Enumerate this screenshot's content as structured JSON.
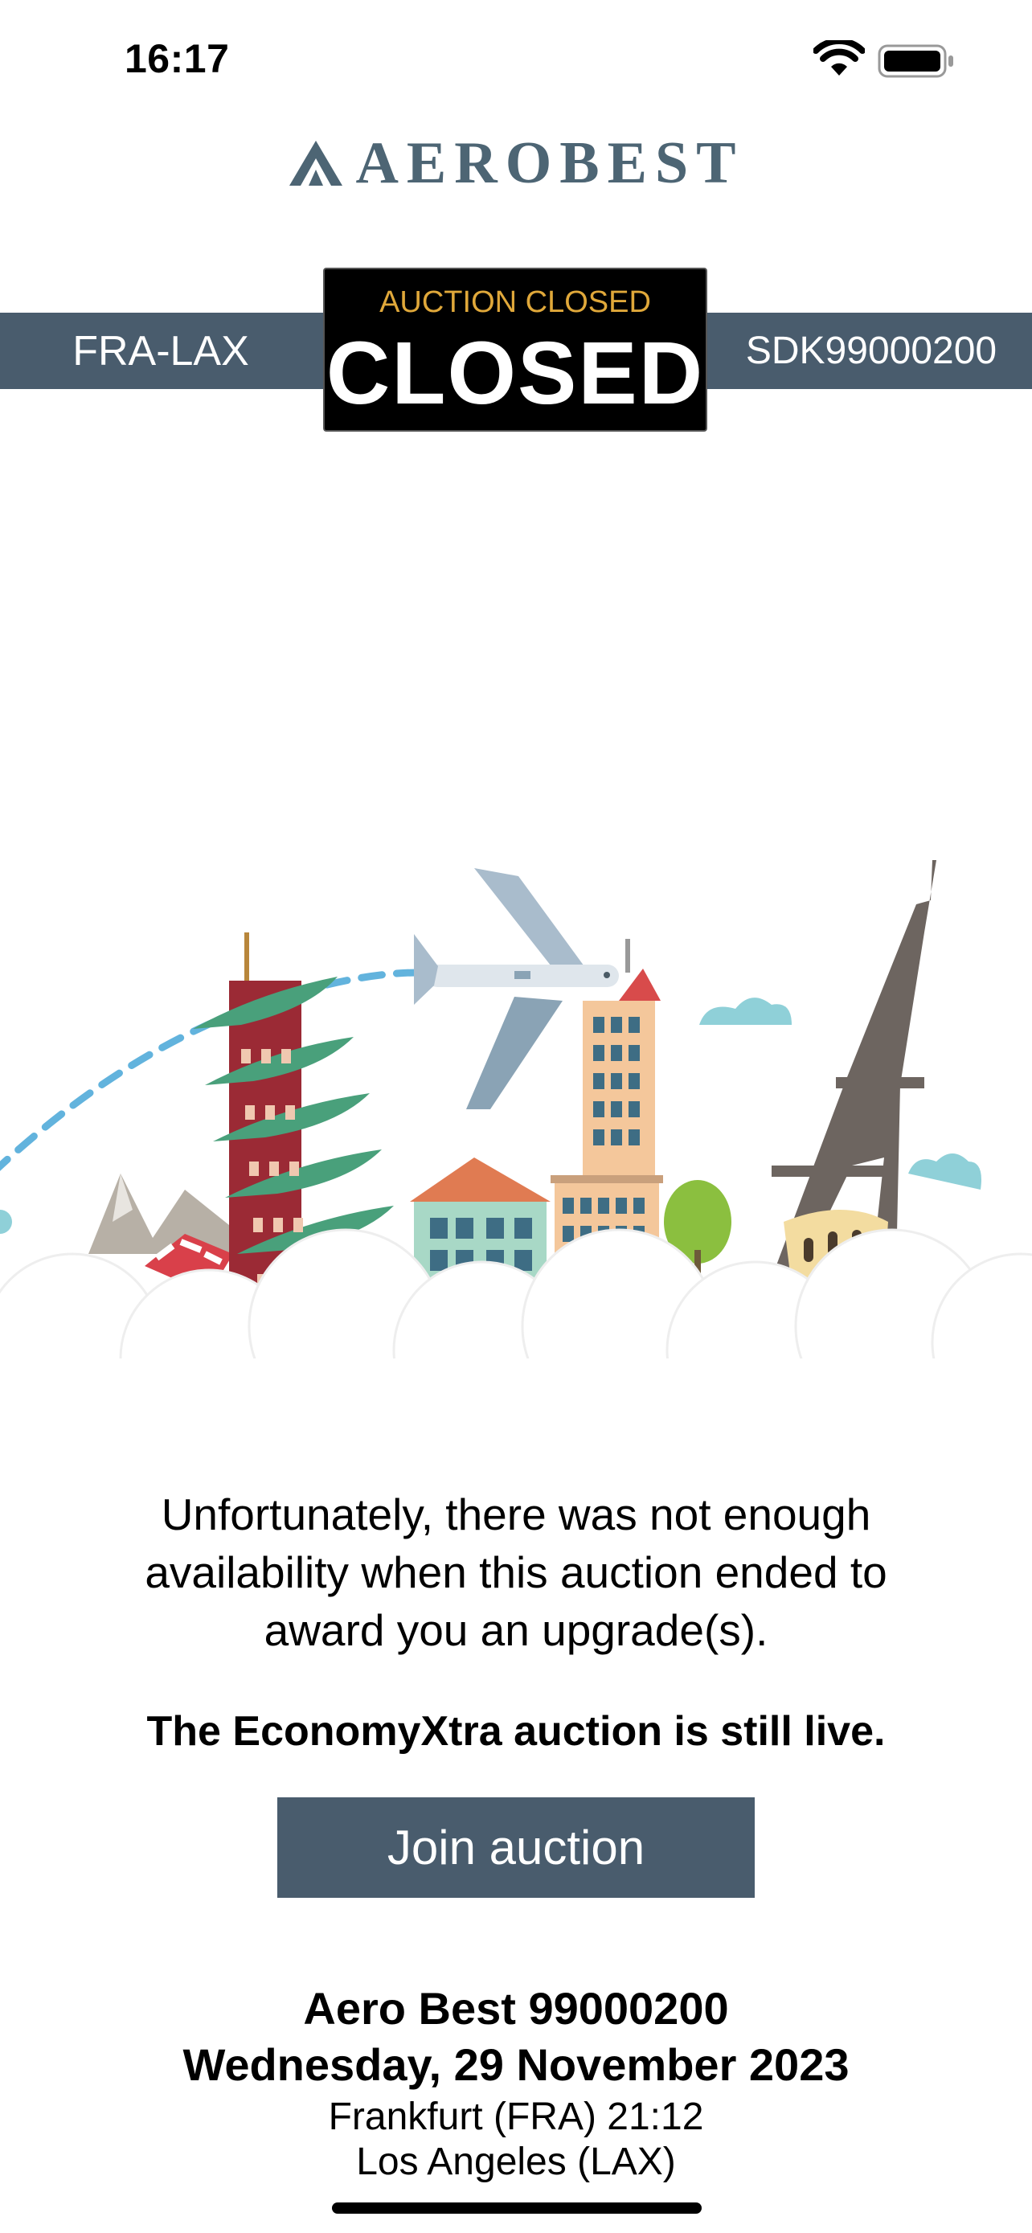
{
  "status_bar": {
    "time": "16:17",
    "wifi": "wifi-icon",
    "battery": "battery-icon"
  },
  "brand": {
    "name": "AEROBEST",
    "color": "#4d6574"
  },
  "header": {
    "route": "FRA-LAX",
    "booking_ref": "SDK99000200",
    "badge_subtitle": "AUCTION CLOSED",
    "badge_title": "CLOSED",
    "band_color": "#495c6d",
    "badge_accent": "#e0a83a"
  },
  "illustration": {
    "description_icon": "travel-landmarks-illustration"
  },
  "message": {
    "line1": "Unfortunately, there was not enough",
    "line2": "availability when this auction ended to",
    "line3": "award you an upgrade(s).",
    "live_note": "The EconomyXtra auction is still live."
  },
  "actions": {
    "join_label": "Join auction"
  },
  "flight": {
    "name": "Aero Best 99000200",
    "date": "Wednesday, 29 November 2023",
    "origin": "Frankfurt (FRA) 21:12",
    "destination": "Los Angeles (LAX)"
  }
}
